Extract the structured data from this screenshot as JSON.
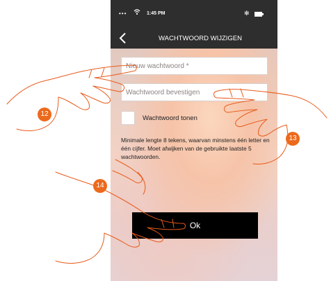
{
  "status_bar": {
    "signal": "•••",
    "time": "1:45 PM",
    "bluetooth": "✻"
  },
  "nav": {
    "back_icon": "chevron-left-icon",
    "title": "WACHTWOORD WIJZIGEN"
  },
  "form": {
    "new_password_placeholder": "Nieuw wachtwoord *",
    "new_password_value": "",
    "confirm_password_placeholder": "Wachtwoord bevestigen",
    "confirm_password_value": "",
    "show_password_label": "Wachtwoord tonen",
    "show_password_checked": false,
    "info_text": "Minimale lengte 8 tekens, waarvan minstens één letter en één cijfer. Moet afwijken van de gebruikte laatste 5 wachtwoorden.",
    "ok_label": "Ok"
  },
  "annotations": {
    "step_12": "12",
    "step_13": "13",
    "step_14": "14"
  },
  "colors": {
    "header_bg": "#2e2e2e",
    "button_bg": "#000000",
    "badge": "#ec6a1c"
  }
}
